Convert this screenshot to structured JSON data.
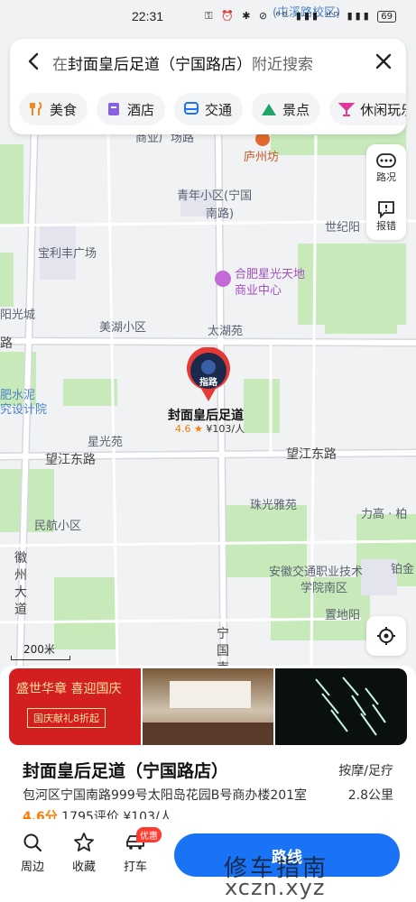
{
  "status_bar": {
    "time": "22:31",
    "right_icons": "⚿ ⏰ ✱ ⊘ ⁶ᴳ ▮▮▮ ᴴᴰ ▮▮▮",
    "battery": "69"
  },
  "search": {
    "prefix": "在",
    "query": "封面皇后足道（宁国路店）",
    "suffix": "附近搜索"
  },
  "categories": [
    "美食",
    "酒店",
    "交通",
    "景点",
    "休闲玩乐"
  ],
  "side_tools": {
    "traffic": "路况",
    "report": "报错"
  },
  "map_labels": {
    "top_place": "(屯溪路校区)",
    "partial_road": "商业广场路",
    "luzhou": "庐州坊",
    "qingnian": "青年小区(宁国",
    "qingnian2": "南路)",
    "shijiyuan": "世纪阳",
    "baolifeng": "宝利丰广场",
    "xingguang": "合肥星光天地",
    "xingguang2": "商业中心",
    "yangguang": "阳光城",
    "lu": "路",
    "meihu": "美湖小区",
    "taihu": "太湖苑",
    "feishuini": "肥水泥",
    "feishuini2": "究设计院",
    "xingguangyuan": "星光苑",
    "wangjiang_left": "望江东路",
    "wangjiang_right": "望江东路",
    "zhuguang": "珠光雅苑",
    "ligao": "力高 · 柏",
    "minhang": "民航小区",
    "anhui": "安徽交通职业技术",
    "anhui2": "学院南区",
    "bo": "铂金",
    "zhiyang": "置地阳",
    "huizhou": "徽州大道",
    "ningguo": "宁国南"
  },
  "pin": {
    "name": "封面皇后足道",
    "rating": "4.6",
    "price": "¥103/人",
    "thumb_text": "指路"
  },
  "scale": "200米",
  "place": {
    "name": "封面皇后足道（宁国路店）",
    "type": "按摩/足疗",
    "address": "包河区宁国南路999号太阳岛花园B号商办楼201室",
    "distance": "2.8公里",
    "score": "4.6分",
    "reviews": "1795评价",
    "avg_price": "¥103/人",
    "photo1_line1": "盛世华章 喜迎国庆",
    "photo1_line2": "国庆献礼8折起"
  },
  "tabs": [
    "周边",
    "收藏",
    "打车"
  ],
  "taxi_badge": "优惠",
  "route_button": "路线",
  "watermark": {
    "line1": "修车指南",
    "line2": "xczn.xyz"
  },
  "colors": {
    "accent": "#1a73f5",
    "score": "#ff7a00",
    "pin": "#e53935",
    "park": "#c8eabb"
  }
}
